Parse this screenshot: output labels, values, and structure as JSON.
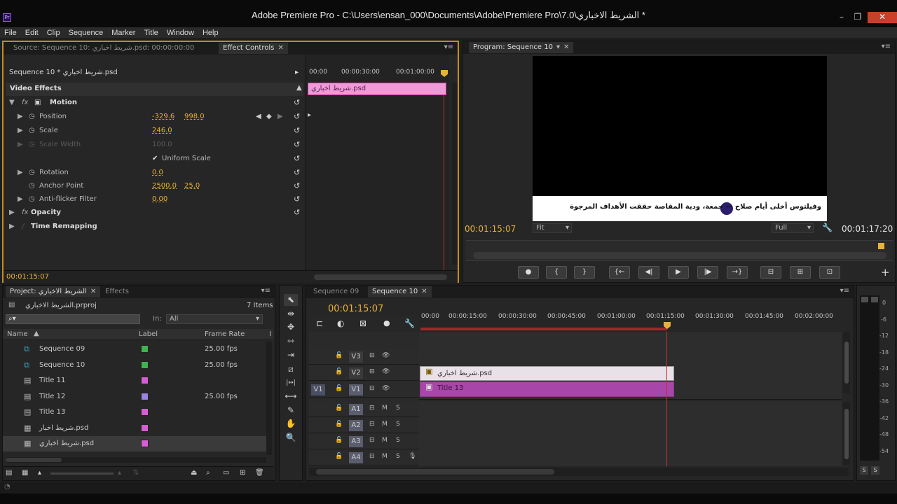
{
  "window": {
    "title": "Adobe Premiere Pro - C:\\Users\\ensan_000\\Documents\\Adobe\\Premiere Pro\\7.0\\الشريط الاخباري *",
    "app_badge": "Pr",
    "minimize": "–",
    "maximize": "❐",
    "close": "✕"
  },
  "menu": [
    "File",
    "Edit",
    "Clip",
    "Sequence",
    "Marker",
    "Title",
    "Window",
    "Help"
  ],
  "source_panel": {
    "tabs": [
      {
        "label": "Source: Sequence 10: شريط اخباري.psd: 00:00:00:00",
        "selected": false
      },
      {
        "label": "Effect Controls",
        "selected": true
      }
    ],
    "clip_name": "Sequence 10 * شريط اخباري.psd",
    "mini_ruler": [
      "00:00",
      "00:00:30:00",
      "00:01:00:00"
    ],
    "clip_bar_label": "شريط اخباري.psd",
    "section": "Video Effects",
    "effects": [
      {
        "name": "Motion",
        "fx": true,
        "bold": true
      },
      {
        "name": "Position",
        "v1": "-329.6",
        "v2": "998.0"
      },
      {
        "name": "Scale",
        "v1": "246.0"
      },
      {
        "name": "Scale Width",
        "v1": "100.0",
        "disabled": true
      },
      {
        "name": "Uniform Scale",
        "checkbox": true
      },
      {
        "name": "Rotation",
        "v1": "0.0"
      },
      {
        "name": "Anchor Point",
        "v1": "2500.0",
        "v2": "25.0"
      },
      {
        "name": "Anti-flicker Filter",
        "v1": "0.00"
      },
      {
        "name": "Opacity",
        "fx": true
      },
      {
        "name": "Time Remapping"
      }
    ],
    "timecode": "00:01:15:07"
  },
  "program_panel": {
    "tab": "Program: Sequence 10",
    "ticker": "وفيلتوس أخلى أيام صلاح — جمعة، ودية المقاصة حققت الأهداف المرجوة",
    "timecode_left": "00:01:15:07",
    "zoom": "Fit",
    "quality": "Full",
    "timecode_right": "00:01:17:20",
    "transport": [
      "●",
      "{",
      "}",
      "{←",
      "◀|",
      "▶",
      "|▶",
      "→}",
      "⊟",
      "⊞",
      "⊡"
    ],
    "add_button": "+"
  },
  "project_panel": {
    "tabs": [
      {
        "label": "Project: الشريط الاخباري",
        "selected": true
      },
      {
        "label": "Effects",
        "selected": false
      }
    ],
    "project_file": "الشريط الاخباري.prproj",
    "item_count": "7 Items",
    "in_label": "In:",
    "in_value": "All",
    "columns": [
      "Name",
      "Label",
      "Frame Rate",
      "I"
    ],
    "items": [
      {
        "name": "Sequence 09",
        "label_color": "#3fb34f",
        "fps": "25.00 fps",
        "icon": "sequence"
      },
      {
        "name": "Sequence 10",
        "label_color": "#3fb34f",
        "fps": "25.00 fps",
        "icon": "sequence"
      },
      {
        "name": "Title 11",
        "label_color": "#d45fd4",
        "fps": "",
        "icon": "title"
      },
      {
        "name": "Title 12",
        "label_color": "#9a84e0",
        "fps": "25.00 fps",
        "icon": "title"
      },
      {
        "name": "Title 13",
        "label_color": "#d45fd4",
        "fps": "",
        "icon": "title"
      },
      {
        "name": "شريط اخبار.psd",
        "label_color": "#d45fd4",
        "fps": "",
        "icon": "still"
      },
      {
        "name": "شريط اخباري.psd",
        "label_color": "#d45fd4",
        "fps": "",
        "icon": "still"
      }
    ]
  },
  "tools": [
    "⬉",
    "⇹",
    "✥",
    "⇿",
    "⇥",
    "⧄",
    "|↔|",
    "⟷",
    "✎",
    "✋",
    "🔍"
  ],
  "timeline": {
    "tabs": [
      {
        "label": "Sequence 09",
        "selected": false
      },
      {
        "label": "Sequence 10",
        "selected": true
      }
    ],
    "timecode": "00:01:15:07",
    "ruler": [
      "00:00",
      "00:00:15:00",
      "00:00:30:00",
      "00:00:45:00",
      "00:01:00:00",
      "00:01:15:00",
      "00:01:30:00",
      "00:01:45:00",
      "00:02:00:00"
    ],
    "video_tracks": [
      "V3",
      "V2",
      "V1"
    ],
    "audio_tracks": [
      "A1",
      "A2",
      "A3",
      "A4"
    ],
    "source_patch": "V1",
    "clips": [
      {
        "track": "V2",
        "label": "شريط اخباري.psd",
        "color": "#e8e2e8"
      },
      {
        "track": "V1",
        "label": "Title 13",
        "color": "#a946a9"
      }
    ]
  },
  "meters": {
    "scale": [
      "0",
      "-6",
      "-12",
      "-18",
      "-24",
      "-30",
      "-36",
      "-42",
      "-48",
      "-54"
    ],
    "solo": [
      "S",
      "S"
    ]
  }
}
